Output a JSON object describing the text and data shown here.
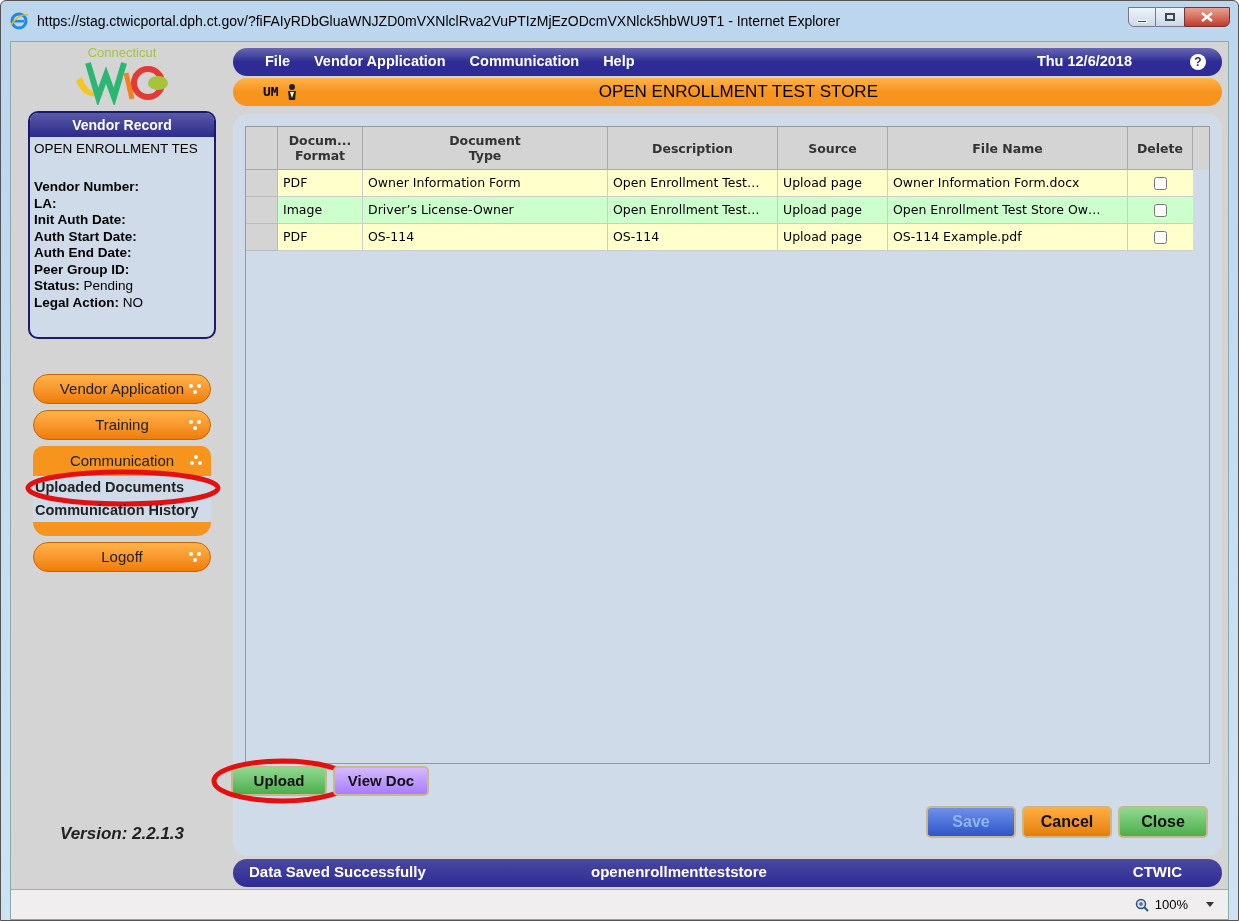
{
  "window": {
    "title": "https://stag.ctwicportal.dph.ct.gov/?fiFAIyRDbGluaWNJZD0mVXNlclRva2VuPTIzMjEzODcmVXNlck5hbWU9T1 - Internet Explorer"
  },
  "logo": {
    "state": "Connecticut"
  },
  "menu": [
    "File",
    "Vendor Application",
    "Communication",
    "Help"
  ],
  "date": "Thu 12/6/2018",
  "help_icon": "?",
  "user_badge": "UM",
  "store_title": "OPEN ENROLLMENT TEST STORE",
  "vendor_record": {
    "title": "Vendor Record",
    "name": "OPEN ENROLLMENT TES",
    "fields": [
      {
        "label": "Vendor Number:"
      },
      {
        "label": "LA:"
      },
      {
        "label": "Init Auth Date:"
      },
      {
        "label": "Auth Start Date:"
      },
      {
        "label": "Auth End Date:"
      },
      {
        "label": "Peer Group ID:"
      },
      {
        "label": "Status:",
        "value": "Pending"
      },
      {
        "label": "Legal Action:",
        "value": "NO"
      }
    ]
  },
  "nav": [
    {
      "label": "Vendor Application",
      "expanded": false
    },
    {
      "label": "Training",
      "expanded": false
    },
    {
      "label": "Communication",
      "expanded": true,
      "children": [
        {
          "label": "Uploaded Documents",
          "circled": true
        },
        {
          "label": "Communication History",
          "circled": false
        }
      ]
    },
    {
      "label": "Logoff",
      "expanded": false
    }
  ],
  "version": "Version: 2.2.1.3",
  "table": {
    "columns": [
      "Docum...\nFormat",
      "Document\nType",
      "Description",
      "Source",
      "File Name",
      "Delete"
    ],
    "rows": [
      {
        "color": "#ffffcc",
        "cells": [
          "PDF",
          "Owner Information Form",
          "Open Enrollment Test…",
          "Upload page",
          "Owner Information Form.docx"
        ],
        "checked": false
      },
      {
        "color": "#ccffcc",
        "cells": [
          "Image",
          "Driver’s License-Owner",
          "Open Enrollment Test…",
          "Upload page",
          "Open Enrollment Test Store Ow…"
        ],
        "checked": false
      },
      {
        "color": "#ffffcc",
        "cells": [
          "PDF",
          "OS-114",
          "OS-114",
          "Upload page",
          "OS-114 Example.pdf"
        ],
        "checked": false
      }
    ]
  },
  "doc_buttons": [
    {
      "label": "Upload",
      "kind": "green",
      "circled": true
    },
    {
      "label": "View Doc",
      "kind": "purple",
      "circled": false
    }
  ],
  "action_buttons": [
    {
      "label": "Save",
      "kind": "blue",
      "disabled": true
    },
    {
      "label": "Cancel",
      "kind": "orange",
      "disabled": false
    },
    {
      "label": "Close",
      "kind": "green",
      "disabled": false
    }
  ],
  "status_bar": {
    "message": "Data Saved Successfully",
    "user": "openenrollmentteststore",
    "app": "CTWIC"
  },
  "zoom": "100%"
}
